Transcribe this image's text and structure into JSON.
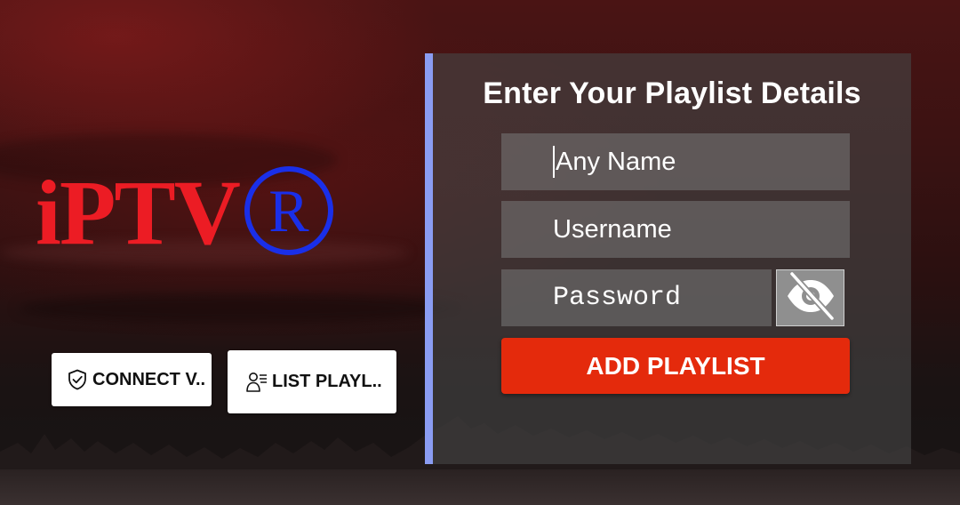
{
  "logo": {
    "text": "iPTV",
    "registered_mark": "R",
    "text_color": "#ec1c24",
    "mark_color": "#1a2fe8"
  },
  "quick_actions": {
    "vpn_label": "CONNECT V..",
    "vpn_icon": "shield-check-icon",
    "list_label": "LIST PLAYL..",
    "list_icon": "user-list-icon"
  },
  "form": {
    "title": "Enter Your Playlist Details",
    "name_placeholder": "Any Name",
    "username_placeholder": "Username",
    "password_placeholder": "Password",
    "toggle_icon": "eye-slash-icon",
    "submit_label": "ADD PLAYLIST",
    "accent_color": "#8a9cf2",
    "submit_color": "#e42a0c"
  }
}
